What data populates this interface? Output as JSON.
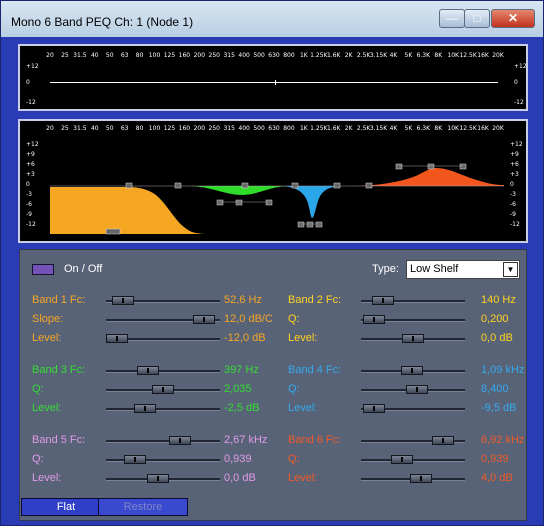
{
  "window": {
    "title": "Mono 6 Band PEQ   Ch: 1   (Node 1)",
    "minimize": "—",
    "maximize": "□",
    "close": "✕"
  },
  "freq_labels": [
    "20",
    "25",
    "31.5",
    "40",
    "50",
    "63",
    "80",
    "100",
    "125",
    "160",
    "200",
    "250",
    "315",
    "400",
    "500",
    "630",
    "800",
    "1K",
    "1.25K",
    "1.6K",
    "2K",
    "2.5K",
    "3.15K",
    "4K",
    "5K",
    "6.3K",
    "8K",
    "10K",
    "12.5K",
    "16K",
    "20K"
  ],
  "top_graph": {
    "y_labels": [
      "+12",
      "0",
      "-12"
    ]
  },
  "main_graph": {
    "y_labels": [
      "+12",
      "+9",
      "+6",
      "+3",
      "0",
      "-3",
      "-6",
      "-9",
      "-12"
    ]
  },
  "onoff": {
    "label": "On / Off"
  },
  "type": {
    "label": "Type:",
    "value": "Low Shelf",
    "arrow": "▼"
  },
  "bands": [
    {
      "color": "#f5a623",
      "rows": [
        {
          "label": "Band 1 Fc:",
          "value": "52,6 Hz",
          "pos": 0.06
        },
        {
          "label": "Slope:",
          "value": "12,0 dB/C",
          "pos": 0.95
        },
        {
          "label": "Level:",
          "value": "-12,0 dB",
          "pos": 0.0
        }
      ]
    },
    {
      "color": "#ffd21f",
      "rows": [
        {
          "label": "Band 2 Fc:",
          "value": "140 Hz",
          "pos": 0.13
        },
        {
          "label": "Q:",
          "value": "0,200",
          "pos": 0.02
        },
        {
          "label": "Level:",
          "value": "0,0 dB",
          "pos": 0.5
        }
      ]
    },
    {
      "color": "#33dd33",
      "rows": [
        {
          "label": "Band 3 Fc:",
          "value": "397 Hz",
          "pos": 0.34
        },
        {
          "label": "Q:",
          "value": "2,035",
          "pos": 0.5
        },
        {
          "label": "Level:",
          "value": "-2,5 dB",
          "pos": 0.3
        }
      ]
    },
    {
      "color": "#33aaee",
      "rows": [
        {
          "label": "Band 4 Fc:",
          "value": "1,09 kHz",
          "pos": 0.49
        },
        {
          "label": "Q:",
          "value": "8,400",
          "pos": 0.55
        },
        {
          "label": "Level:",
          "value": "-9,5 dB",
          "pos": 0.02
        }
      ]
    },
    {
      "color": "#e09ae8",
      "rows": [
        {
          "label": "Band 5 Fc:",
          "value": "2,67 kHz",
          "pos": 0.69
        },
        {
          "label": "Q:",
          "value": "0,939",
          "pos": 0.2
        },
        {
          "label": "Level:",
          "value": "0,0 dB",
          "pos": 0.45
        }
      ]
    },
    {
      "color": "#f05a28",
      "rows": [
        {
          "label": "Band 6 Fc:",
          "value": "6,92 kHz",
          "pos": 0.86
        },
        {
          "label": "Q:",
          "value": "0,939",
          "pos": 0.37
        },
        {
          "label": "Level:",
          "value": "4,0 dB",
          "pos": 0.6
        }
      ]
    }
  ],
  "buttons": {
    "flat": "Flat",
    "restore": "Restore"
  }
}
